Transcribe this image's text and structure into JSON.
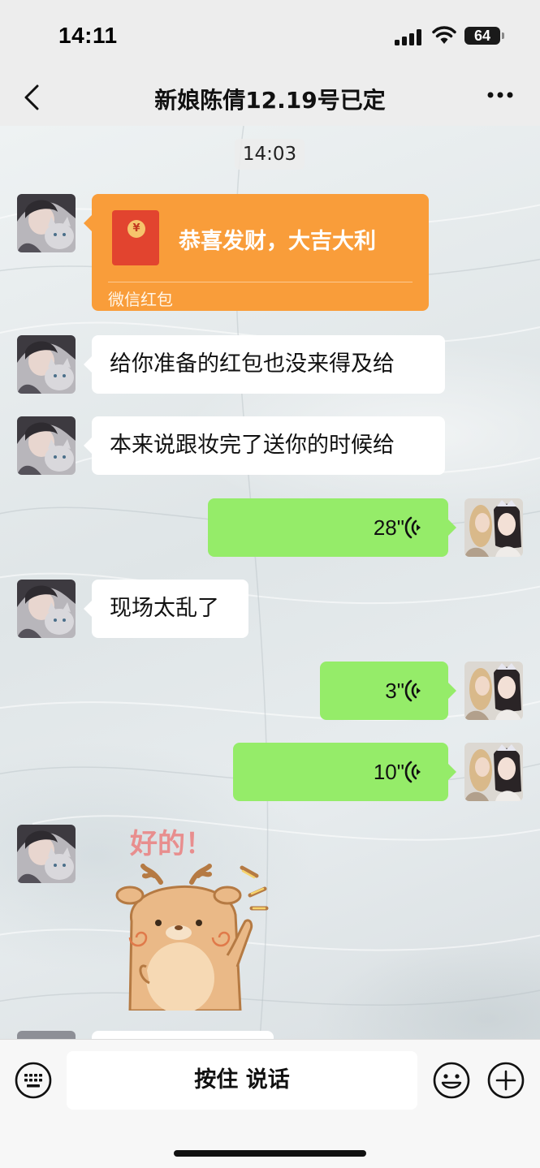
{
  "status_bar": {
    "time": "14:11",
    "battery": "64"
  },
  "header": {
    "title": "新娘陈倩12.19号已定"
  },
  "timestamp": "14:03",
  "messages": [
    {
      "type": "red_packet",
      "from": "other",
      "greeting": "恭喜发财，大吉大利",
      "label": "微信红包"
    },
    {
      "type": "text",
      "from": "other",
      "text": "给你准备的红包也没来得及给"
    },
    {
      "type": "text",
      "from": "other",
      "text": "本来说跟妆完了送你的时候给"
    },
    {
      "type": "voice",
      "from": "self",
      "duration": "28\""
    },
    {
      "type": "text",
      "from": "other",
      "text": "现场太乱了"
    },
    {
      "type": "voice",
      "from": "self",
      "duration": "3\""
    },
    {
      "type": "voice",
      "from": "self",
      "duration": "10\""
    },
    {
      "type": "sticker",
      "from": "other",
      "text": "好的！"
    }
  ],
  "input_bar": {
    "talk_label": "按住 说话"
  },
  "colors": {
    "self_bubble": "#95ec69",
    "other_bubble": "#ffffff",
    "red_packet": "#f99d3a",
    "background": "#ededed"
  },
  "icons": [
    "back-icon",
    "more-icon",
    "keyboard-icon",
    "emoji-icon",
    "plus-icon",
    "voice-wave-icon",
    "red-packet-icon"
  ]
}
